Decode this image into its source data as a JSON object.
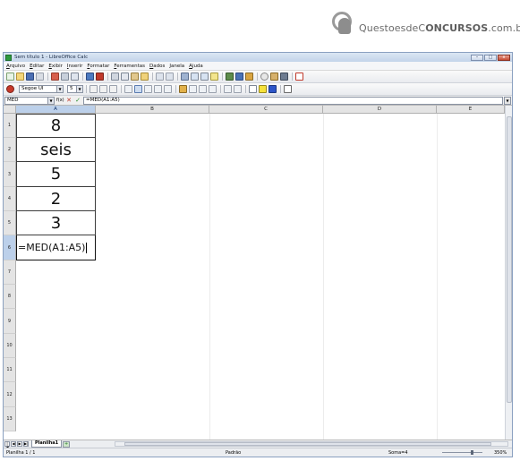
{
  "watermark": {
    "brand_prefix": "QuestoesdeC",
    "brand_mid": "ONCURSOS",
    "brand_suffix": ".com.br"
  },
  "window": {
    "title": "Sem título 1 - LibreOffice Calc",
    "min": "–",
    "max": "□",
    "close": "x"
  },
  "menu": [
    "Arquivo",
    "Editar",
    "Exibir",
    "Inserir",
    "Formatar",
    "Ferramentas",
    "Dados",
    "Janela",
    "Ajuda"
  ],
  "format": {
    "font_name": "Segoe UI",
    "font_size": "5"
  },
  "formula_bar": {
    "name_box": "MED",
    "formula": "=MED(A1:A5)",
    "function_icon": "f(x)",
    "cancel_icon": "✕",
    "accept_icon": "✓"
  },
  "grid": {
    "columns": [
      "A",
      "B",
      "C",
      "D",
      "E"
    ],
    "rows": [
      "1",
      "2",
      "3",
      "4",
      "5",
      "6",
      "7",
      "8",
      "9",
      "10",
      "11",
      "12",
      "13"
    ],
    "cells": [
      "8",
      "seis",
      "5",
      "2",
      "3"
    ],
    "editing_text": "=MED(A1:A5)"
  },
  "tabs": {
    "sheet": "Planilha1"
  },
  "status": {
    "sheet_pos": "Planilha 1 / 1",
    "style": "Padrão",
    "sum": "Soma=4",
    "zoom": "350%"
  },
  "colors": {
    "selected_header": "#bcd0ea",
    "title_gradient": "#c3d4ea",
    "close_button": "#c54a33"
  }
}
